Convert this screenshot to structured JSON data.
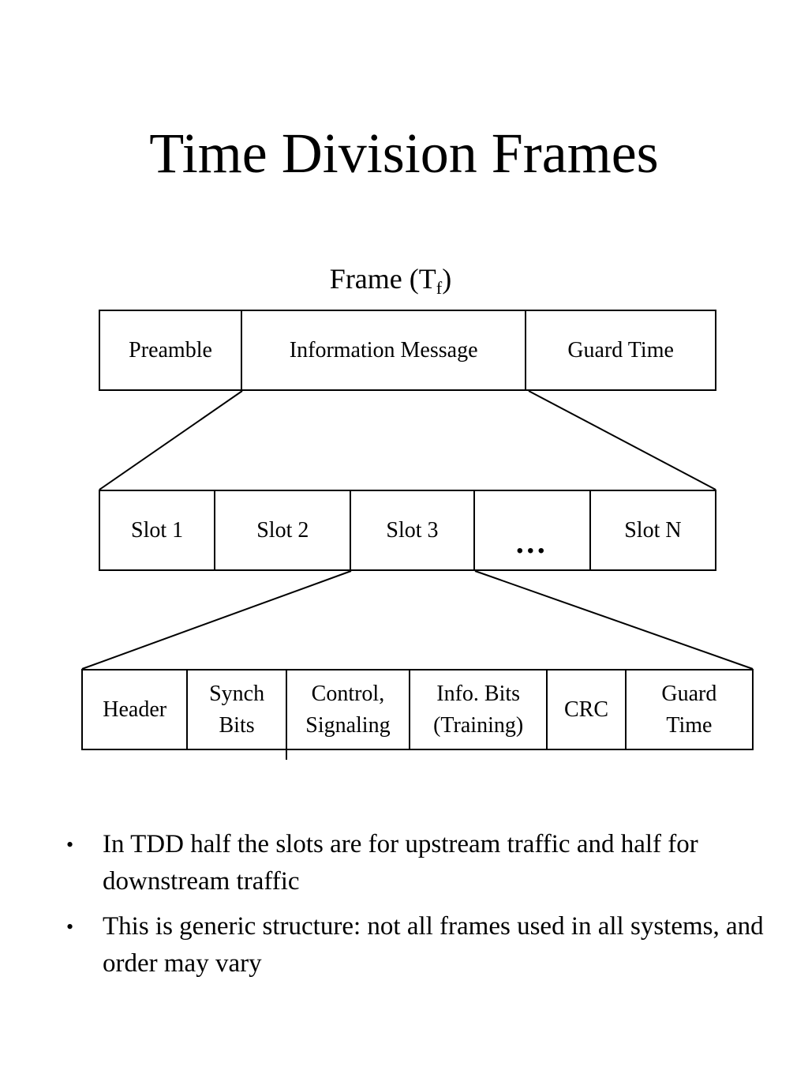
{
  "slide": {
    "title": "Time Division Frames",
    "frame_label": {
      "base": "Frame (T",
      "subscript": "f",
      "close": ")"
    }
  },
  "diagram": {
    "frame_row": {
      "name": "frame-structure-row",
      "cells": [
        {
          "label": "Preamble"
        },
        {
          "label": "Information Message"
        },
        {
          "label": "Guard Time"
        }
      ]
    },
    "slots_row": {
      "name": "slot-structure-row",
      "cells": [
        {
          "label": "Slot 1"
        },
        {
          "label": "Slot 2"
        },
        {
          "label": "Slot 3"
        },
        {
          "label": "…"
        },
        {
          "label": "Slot N"
        }
      ]
    },
    "burst_row": {
      "name": "slot-detail-row",
      "cells": [
        {
          "line1": "Header",
          "line2": ""
        },
        {
          "line1": "Synch",
          "line2": "Bits"
        },
        {
          "line1": "Control,",
          "line2": "Signaling"
        },
        {
          "line1": "Info. Bits",
          "line2": "(Training)"
        },
        {
          "line1": "CRC",
          "line2": ""
        },
        {
          "line1": "Guard",
          "line2": "Time"
        }
      ]
    }
  },
  "bullets": [
    {
      "text": "In TDD half the slots are for upstream traffic and half for downstream traffic",
      "marker": "•"
    },
    {
      "text": "This is generic structure: not all frames used in all systems, and order may vary",
      "marker": "•"
    }
  ],
  "colors": {
    "background": "#ffffff",
    "text": "#000000",
    "line": "#000000"
  }
}
